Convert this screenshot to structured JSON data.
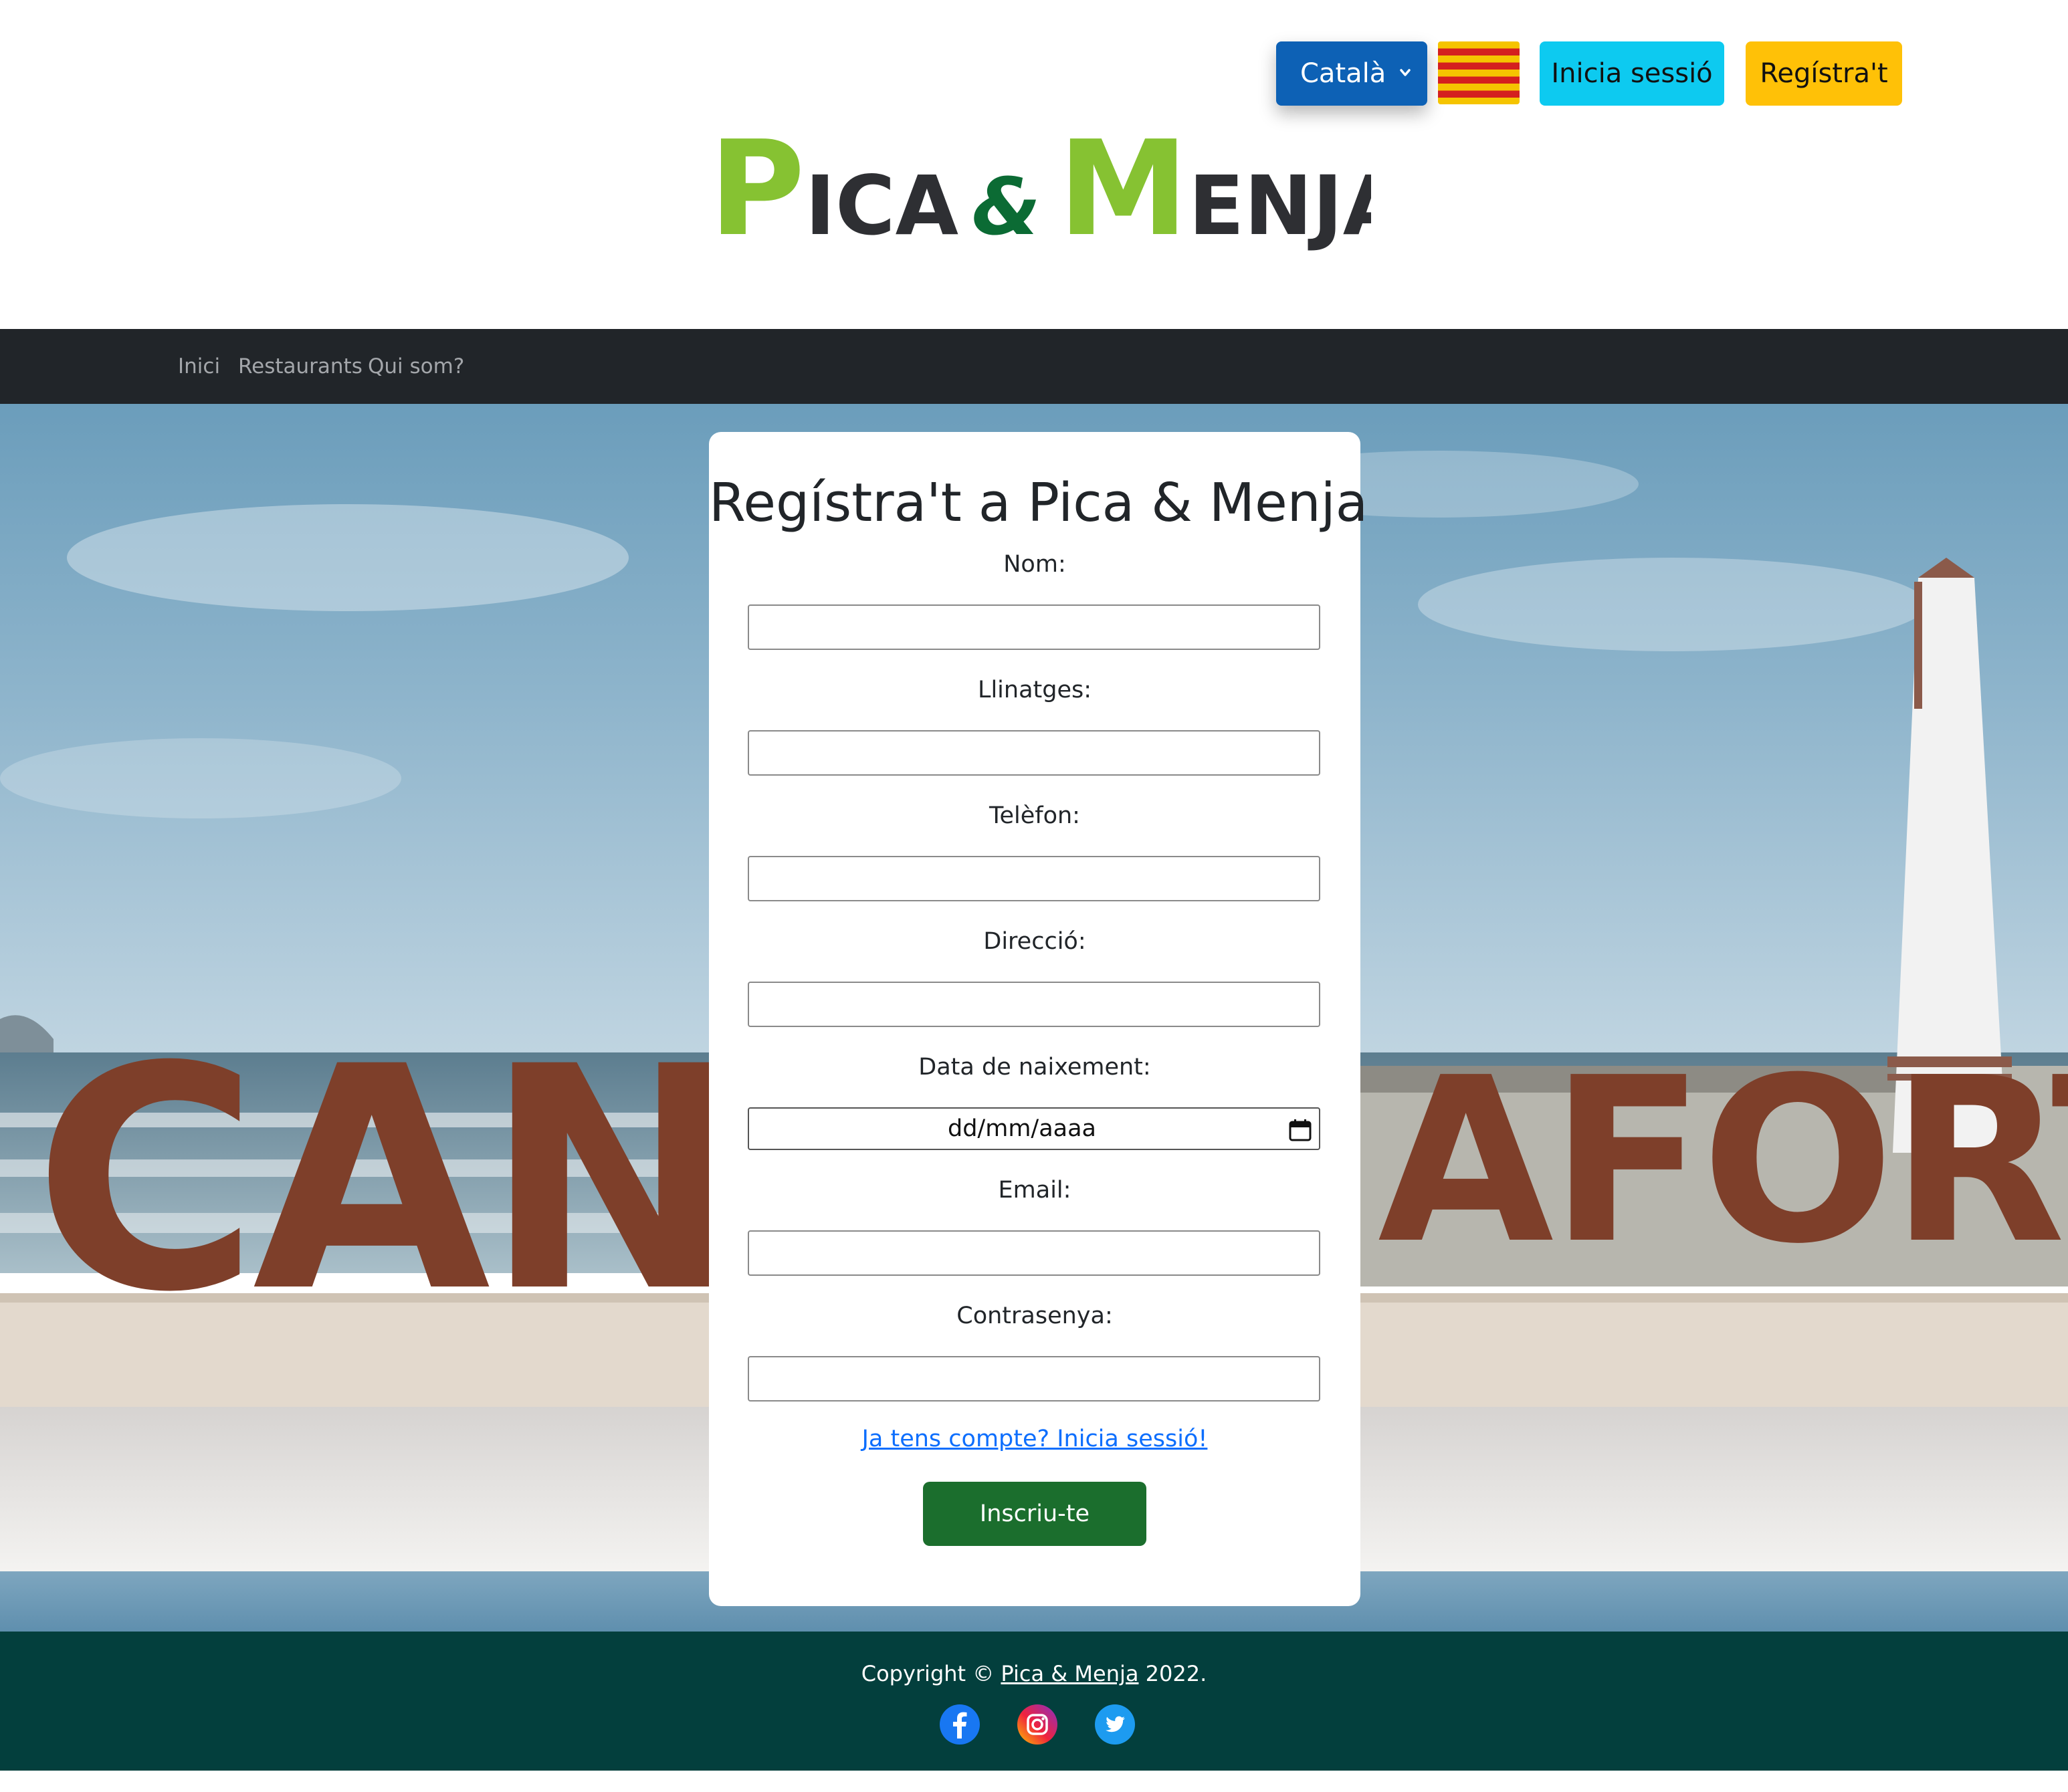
{
  "header": {
    "language_selected": "Català",
    "login_label": "Inicia sessió",
    "register_label": "Regístra't",
    "logo": {
      "word1_initial": "P",
      "word1_rest": "ICA",
      "ampersand": "&",
      "word2_initial": "M",
      "word2_rest": "ENJA"
    }
  },
  "nav": {
    "items": [
      {
        "label": "Inici"
      },
      {
        "label": "Restaurants"
      },
      {
        "label": "Qui som?"
      }
    ]
  },
  "hero": {
    "sign_left": "CAN",
    "sign_right": "AFORT"
  },
  "form": {
    "title": "Regístra't a Pica & Menja",
    "fields": {
      "nom": {
        "label": "Nom:",
        "value": ""
      },
      "llinatges": {
        "label": "Llinatges:",
        "value": ""
      },
      "telefon": {
        "label": "Telèfon:",
        "value": ""
      },
      "direccio": {
        "label": "Direcció:",
        "value": ""
      },
      "data_naixement": {
        "label": "Data de naixement:",
        "placeholder": "dd/mm/aaaa"
      },
      "email": {
        "label": "Email:",
        "value": ""
      },
      "contrasenya": {
        "label": "Contrasenya:",
        "value": ""
      }
    },
    "login_link": "Ja tens compte? Inicia sessió!",
    "submit_label": "Inscriu-te"
  },
  "footer": {
    "copyright_prefix": "Copyright © ",
    "brand": "Pica & Menja",
    "year": " 2022."
  },
  "colors": {
    "logo_green": "#86c232",
    "logo_dark_green": "#0b6b34",
    "logo_text": "#2e2f33",
    "language_select": "#0d61b5",
    "login_button": "#0dcaf0",
    "register_button": "#ffc107",
    "navbar": "#212529",
    "submit_button": "#1b6e2d",
    "footer": "#033f3d",
    "link": "#0d6efd"
  },
  "icons": {
    "language_dropdown": "chevron-down-icon",
    "flag": "catalan-flag-icon",
    "date_picker": "calendar-icon",
    "social": [
      "facebook-icon",
      "instagram-icon",
      "twitter-icon"
    ]
  }
}
